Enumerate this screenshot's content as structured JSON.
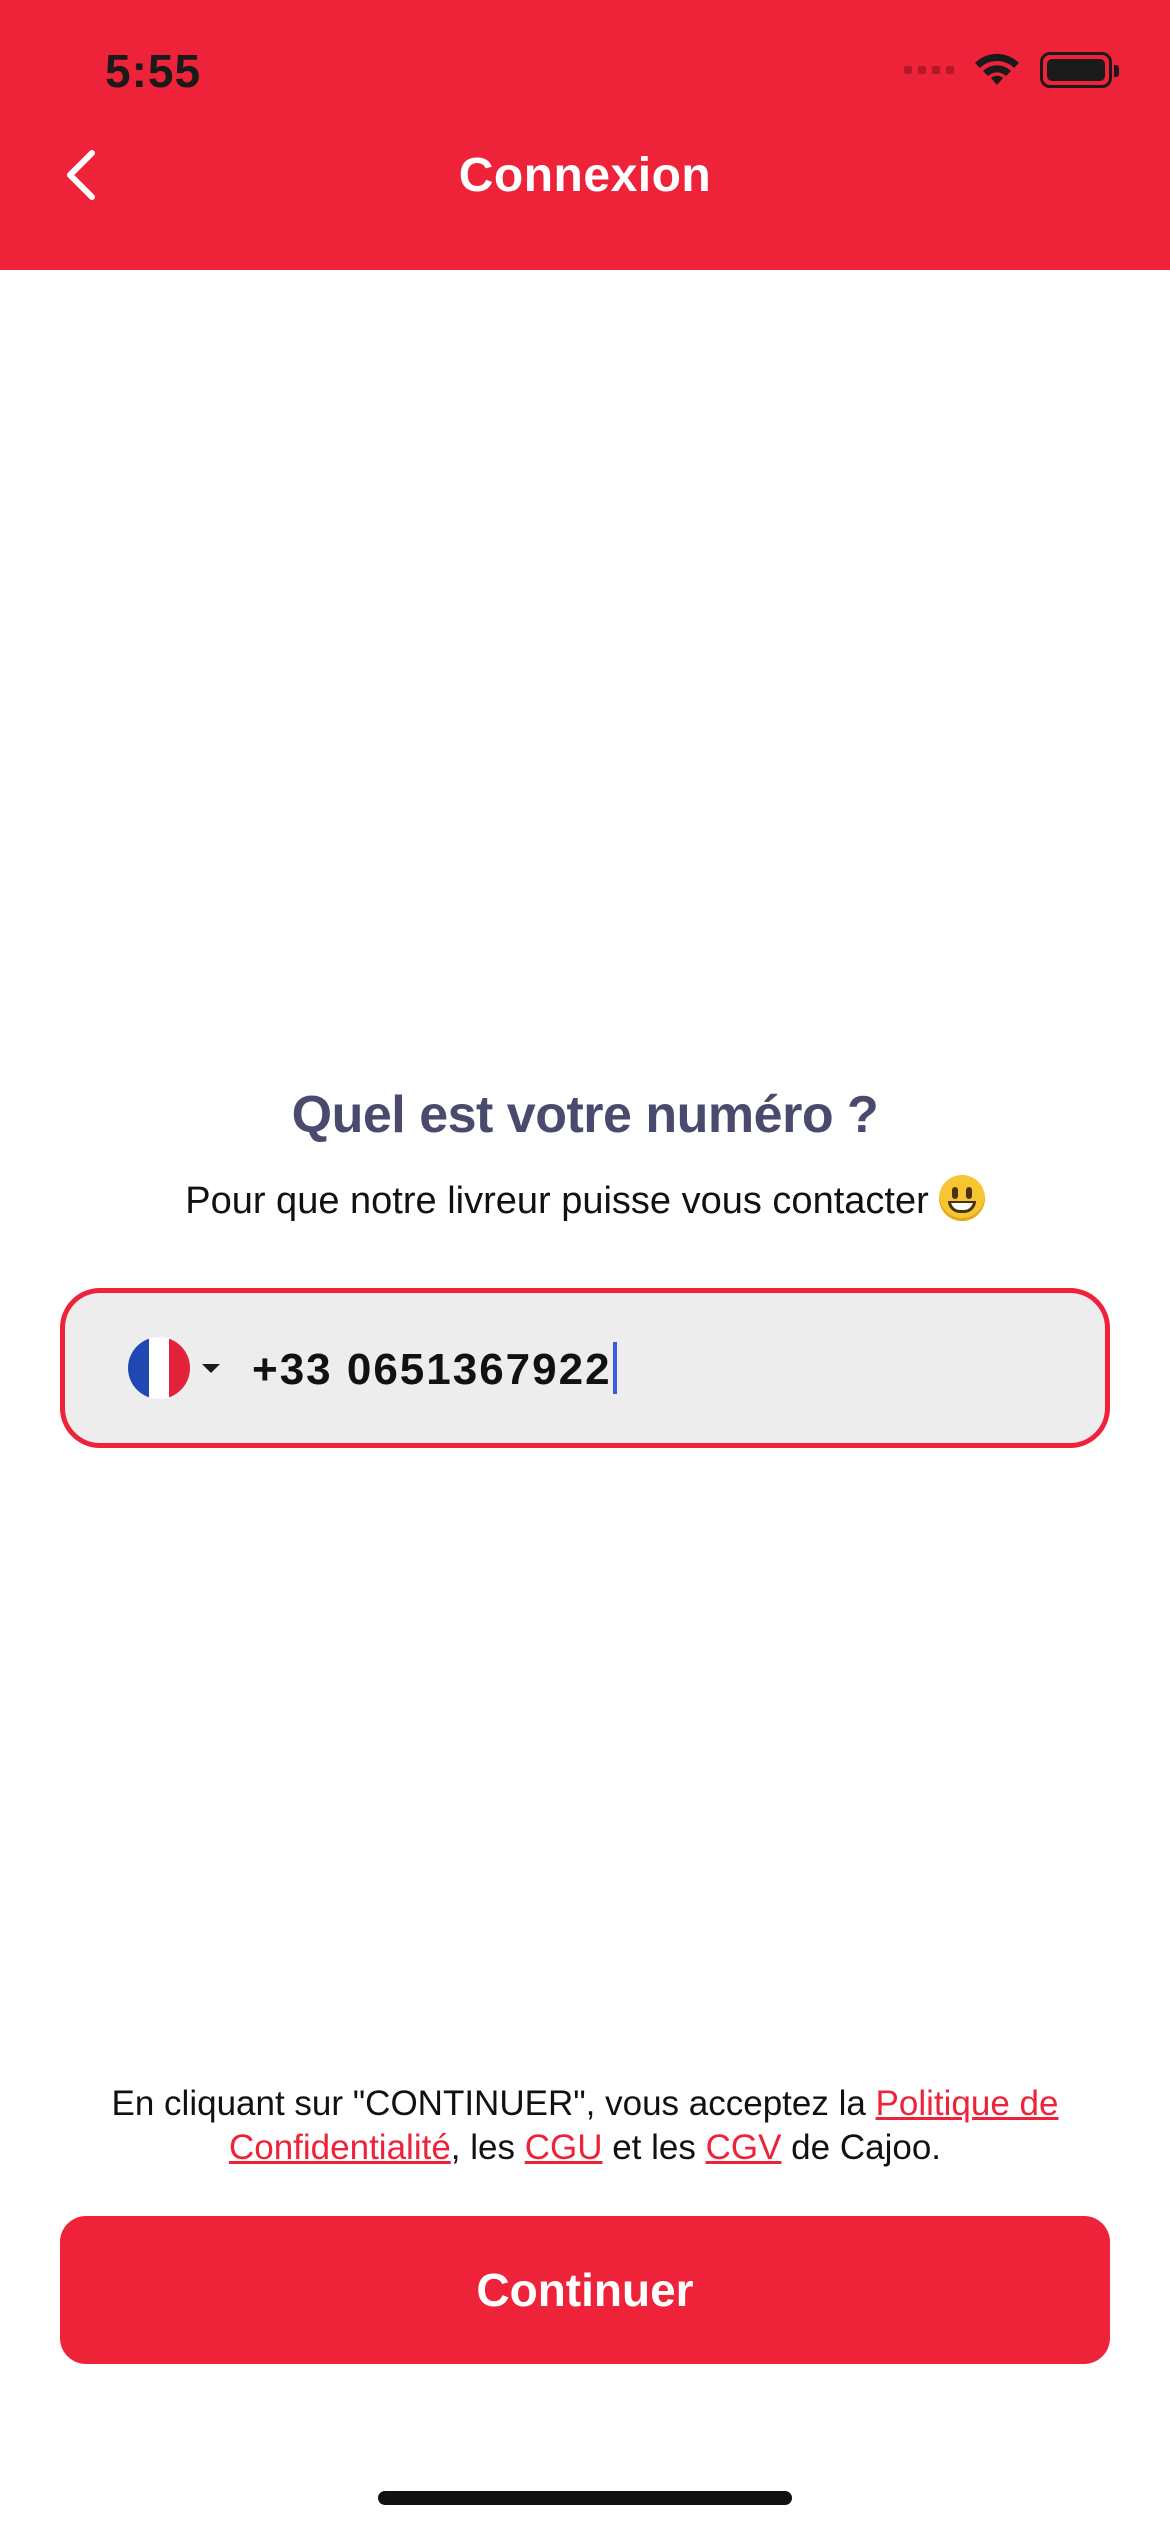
{
  "status_bar": {
    "time": "5:55"
  },
  "header": {
    "title": "Connexion"
  },
  "main": {
    "question": "Quel est votre numéro ?",
    "subtitle": "Pour que notre livreur puisse vous contacter"
  },
  "phone_field": {
    "country": "France",
    "value": "+33 0651367922"
  },
  "legal": {
    "prefix": "En cliquant sur \"CONTINUER\", vous acceptez la ",
    "privacy_link": "Politique de Confidentialité",
    "sep1": ", les ",
    "cgu_link": "CGU",
    "sep2": " et les ",
    "cgv_link": "CGV",
    "suffix": " de Cajoo."
  },
  "actions": {
    "continue_label": "Continuer"
  },
  "colors": {
    "brand_red": "#ee2238",
    "title_navy": "#4a4a6e",
    "field_bg": "#ededed",
    "cursor_blue": "#3b5bdb"
  },
  "icons": [
    "back-chevron-icon",
    "wifi-icon",
    "battery-icon",
    "signal-icon",
    "france-flag-icon",
    "dropdown-caret-icon",
    "grinning-face-emoji"
  ]
}
